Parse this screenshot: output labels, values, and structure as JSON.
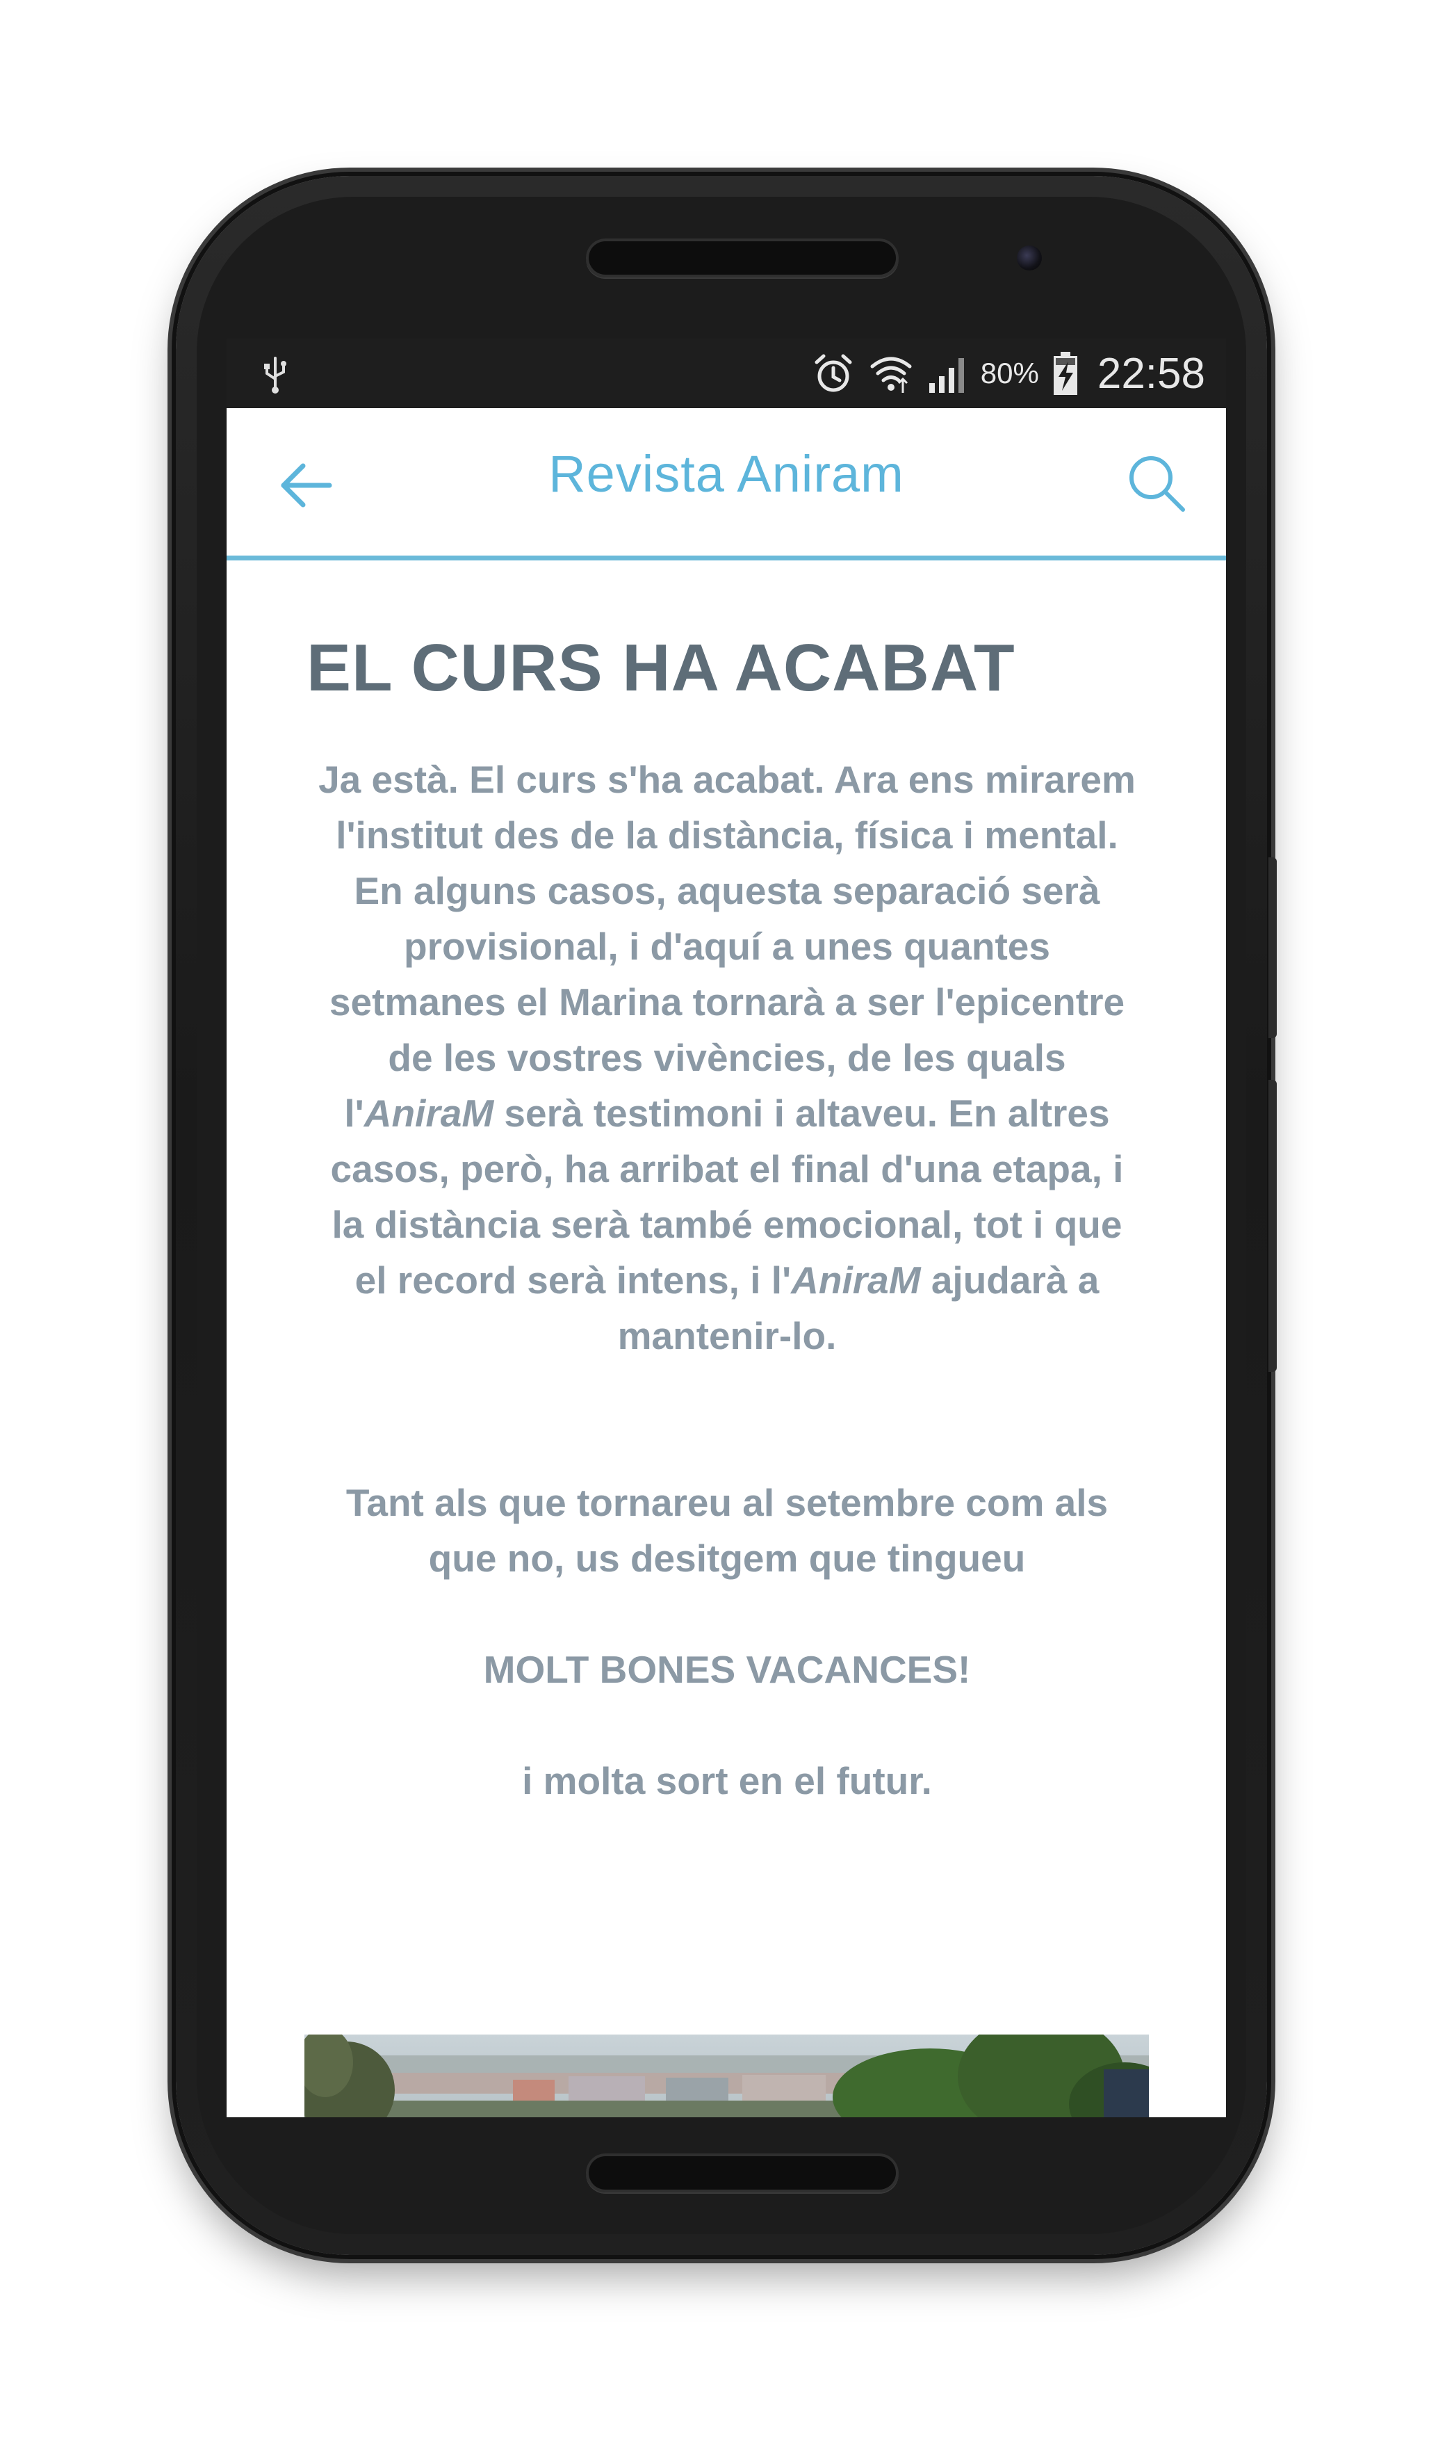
{
  "status_bar": {
    "usb_icon": "usb-icon",
    "alarm_icon": "alarm-clock-icon",
    "wifi_icon": "wifi-icon",
    "signal_icon": "cell-signal-icon",
    "battery_icon": "battery-charging-icon",
    "battery_percent": "80%",
    "battery_level": 0.8,
    "time": "22:58"
  },
  "app_bar": {
    "title": "Revista Aniram",
    "back_icon": "back-arrow-icon",
    "search_icon": "search-icon",
    "accent_color": "#5db5db"
  },
  "article": {
    "title": "EL CURS HA ACABAT",
    "p1_part1": "Ja està. El curs s'ha acabat. Ara ens mirarem l'institut des de la distància, física i mental. En alguns casos, aquesta separació serà provisional, i d'aquí a unes quantes setmanes el Marina tornarà a ser l'epicentre de les vostres vivències, de les quals l'",
    "p1_em1": "AniraM",
    "p1_part2": " serà testimoni i altaveu. En altres casos, però, ha arribat el final d'una etapa, i la distància serà també emocional, tot i que el record serà intens, i l'",
    "p1_em2": "AniraM",
    "p1_part3": " ajudarà a mantenir-lo.",
    "p2": "Tant als que tornareu al setembre com als que no, us desitgem que tingueu",
    "p3": "MOLT BONES VACANCES!",
    "p4": "i molta sort en el futur.",
    "text_color": "#8b99a5",
    "title_color": "#5e6d78"
  }
}
